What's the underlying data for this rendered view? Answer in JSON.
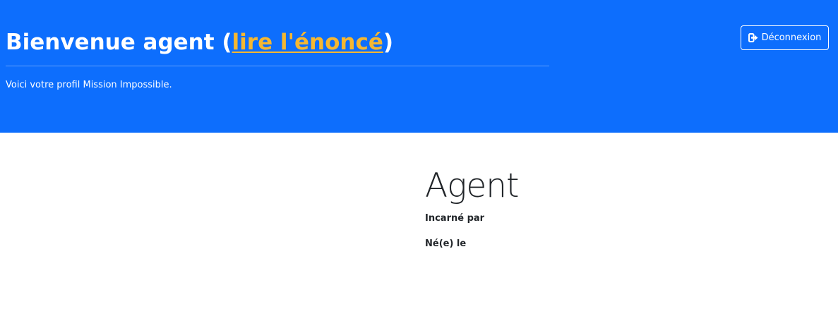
{
  "header": {
    "title_prefix": "Bienvenue agent (",
    "title_link": "lire l'énoncé",
    "title_suffix": ")",
    "lead": "Voici votre profil Mission Impossible.",
    "logout_label": "Déconnexion",
    "logout_icon": "sign-out-icon"
  },
  "profile": {
    "name": "Agent",
    "played_by_label": "Incarné par",
    "born_label": "Né(e) le"
  },
  "colors": {
    "header_bg": "#0d6efd",
    "link": "#f5b731"
  }
}
